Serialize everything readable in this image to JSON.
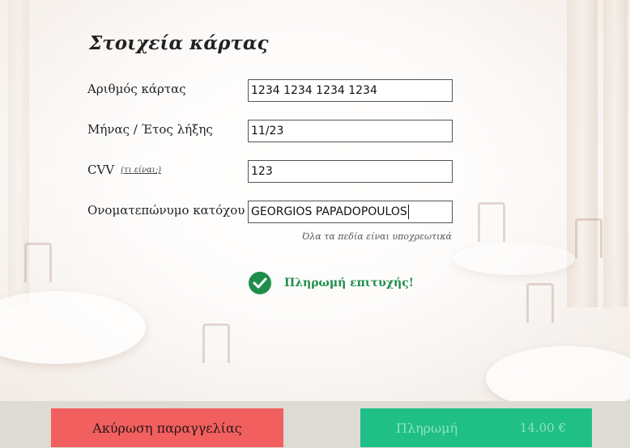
{
  "form": {
    "title": "Στοιχεία κάρτας",
    "fields": [
      {
        "label": "Αριθμός κάρτας",
        "value": "1234 1234 1234 1234"
      },
      {
        "label": "Μήνας / Έτος λήξης",
        "value": "11/23"
      },
      {
        "label": "CVV",
        "value": "123",
        "help_link": "(τι είναι;)"
      },
      {
        "label": "Ονοματεπώνυμο κατόχου",
        "value": "GEORGIOS PAPADOPOULOS"
      }
    ],
    "required_note": "Όλα τα πεδία είναι υποχρεωτικά"
  },
  "status": {
    "message": "Πληρωμή επιτυχής!",
    "icon": "check-circle-icon",
    "color": "#1f8e4a"
  },
  "footer": {
    "cancel_label": "Ακύρωση παραγγελίας",
    "pay_label": "Πληρωμή",
    "pay_amount": "14.00 €",
    "cancel_color": "#f15f5f",
    "pay_color": "#1fbf87"
  }
}
